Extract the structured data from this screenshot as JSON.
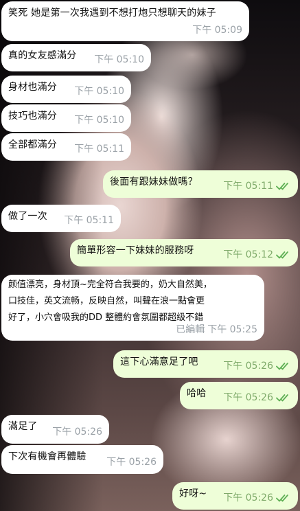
{
  "messages": [
    {
      "dir": "in",
      "text": "笑死 她是第一次我遇到不想打炮只想聊天的妹子",
      "time": "下午 05:09"
    },
    {
      "dir": "in",
      "text": "真的女友感滿分",
      "time": "下午 05:10"
    },
    {
      "dir": "in",
      "text": "身材也滿分",
      "time": "下午 05:10"
    },
    {
      "dir": "in",
      "text": "技巧也滿分",
      "time": "下午 05:10"
    },
    {
      "dir": "in",
      "text": "全部都滿分",
      "time": "下午 05:11"
    },
    {
      "dir": "out",
      "text": "後面有跟妹妹做嗎？",
      "time": "下午 05:11",
      "read": true
    },
    {
      "dir": "in",
      "text": "做了一次",
      "time": "下午 05:11"
    },
    {
      "dir": "out",
      "text": "簡單形容一下妹妹的服務呀",
      "time": "下午 05:12",
      "read": true
    },
    {
      "dir": "in",
      "text": "颜值漂亮，身材頂~完全符合我要的，奶大自然美，\n口技佳，英文流畅，反映自然，叫聲在浪一點會更\n好了，小穴會吸我的DD 整體約會氛圍都超级不錯",
      "time": "下午 05:25",
      "edited": "已編輯"
    },
    {
      "dir": "out",
      "text": "這下心滿意足了吧",
      "time": "下午 05:26",
      "read": true
    },
    {
      "dir": "out",
      "text": "哈哈",
      "time": "下午 05:26",
      "read": true
    },
    {
      "dir": "in",
      "text": "滿足了",
      "time": "下午 05:26"
    },
    {
      "dir": "in",
      "text": "下次有機會再體驗",
      "time": "下午 05:26"
    },
    {
      "dir": "out",
      "text": "好呀~",
      "time": "下午 05:26",
      "read": true
    }
  ],
  "colors": {
    "incoming_bubble": "#ffffff",
    "outgoing_bubble": "#eefed8",
    "read_check": "#5fb055",
    "timestamp_in": "#9aa1a7",
    "timestamp_out": "#7faa6a"
  },
  "icons": {
    "read_receipt": "double-check-icon"
  }
}
